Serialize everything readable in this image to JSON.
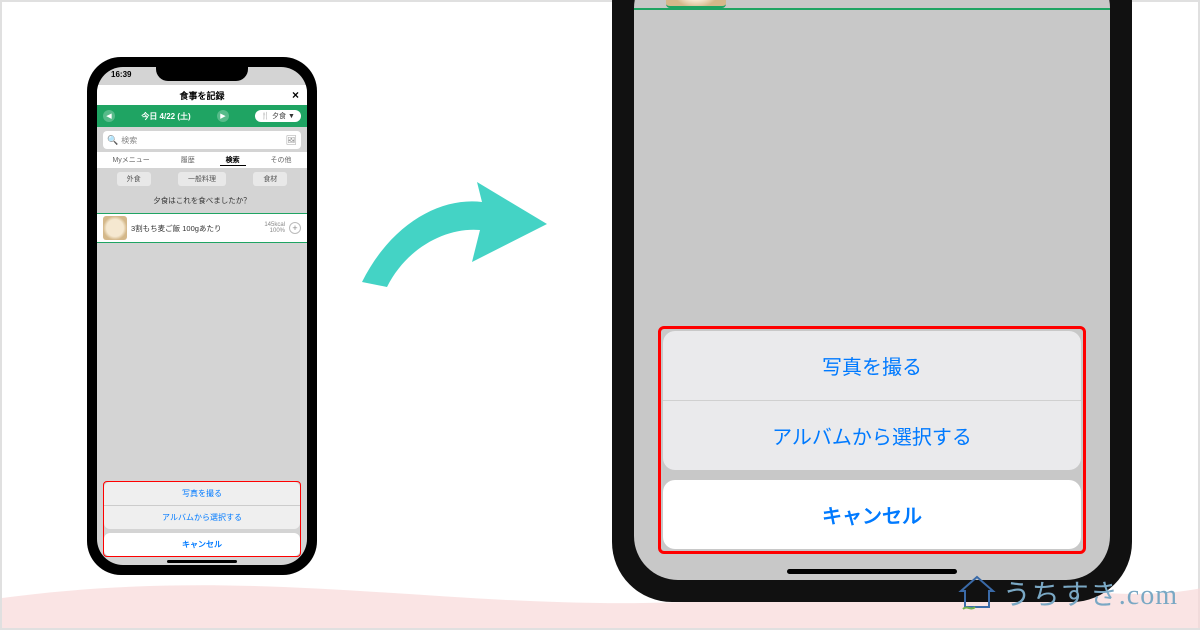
{
  "status": {
    "time": "16:39"
  },
  "header": {
    "title": "食事を記録",
    "close": "×"
  },
  "greenbar": {
    "prev": "◀",
    "date": "今日 4/22 (土)",
    "next": "▶",
    "meal_icon": "🍴",
    "meal": "夕食",
    "chev": "▼"
  },
  "search": {
    "icon": "🔍",
    "placeholder": "検索",
    "photo_icon": "🖼"
  },
  "tabs": [
    {
      "label": "Myメニュー"
    },
    {
      "label": "履歴"
    },
    {
      "label": "検索",
      "active": true
    },
    {
      "label": "その他"
    }
  ],
  "chips": [
    {
      "label": "外食"
    },
    {
      "label": "一般料理"
    },
    {
      "label": "食材"
    }
  ],
  "prompt": "夕食はこれを食べましたか？",
  "food": {
    "name": "3割もち麦ご飯 100gあたり",
    "kcal": "145kcal",
    "pct": "100%",
    "plus": "+"
  },
  "sheet": {
    "take_photo": "写真を撮る",
    "from_album": "アルバムから選択する",
    "cancel": "キャンセル"
  },
  "watermark": {
    "text": "うちすき.com"
  },
  "colors": {
    "accent_green": "#1fa463",
    "ios_blue": "#007aff",
    "highlight_red": "#ff0000",
    "arrow_teal": "#44d3c5"
  }
}
